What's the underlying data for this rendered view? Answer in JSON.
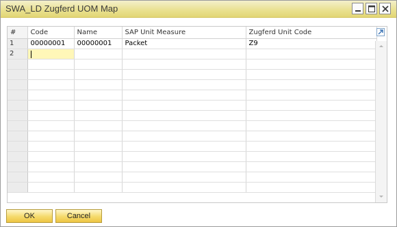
{
  "window": {
    "title": "SWA_LD Zugferd UOM Map",
    "icons": {
      "minimize": "minimize-icon",
      "maximize": "maximize-icon",
      "close": "close-icon"
    }
  },
  "grid": {
    "columns": [
      "#",
      "Code",
      "Name",
      "SAP Unit Measure",
      "Zugferd Unit Code"
    ],
    "rows": [
      {
        "num": "1",
        "code": "00000001",
        "name": "00000001",
        "sap_unit": "Packet",
        "zugferd_code": "Z9"
      },
      {
        "num": "2",
        "code": "",
        "name": "",
        "sap_unit": "",
        "zugferd_code": ""
      }
    ],
    "expand_icon": "expand-arrow-icon",
    "active_row_color": "#fff7b8"
  },
  "buttons": {
    "ok": "OK",
    "cancel": "Cancel"
  }
}
